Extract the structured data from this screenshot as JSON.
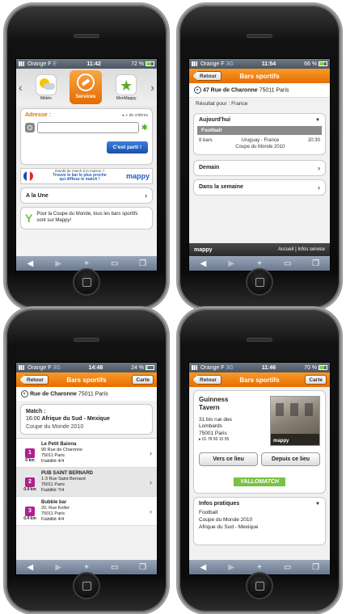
{
  "phone1": {
    "status": {
      "carrier": "Orange F",
      "network": "E",
      "time": "11:42",
      "battery": "72 %"
    },
    "menu": [
      {
        "label": "Météo"
      },
      {
        "label": "Services"
      },
      {
        "label": "MonMappy"
      }
    ],
    "address_label": "Adresse :",
    "criteria_link": "+ de critères",
    "go_button": "C'est parti !",
    "banner_line1": "Interdit de match à la maison ?",
    "banner_line2": "Trouve le bar le plus proche",
    "banner_line3": "qui diffuse le match !",
    "banner_brand": "mappy",
    "une": "A la Une",
    "promo": "Pour la Coupe du Monde, tous les bars sportifs sont sur Mappy!"
  },
  "phone2": {
    "status": {
      "carrier": "Orange F",
      "network": "3G",
      "time": "11:54",
      "battery": "66 %"
    },
    "back": "Retour",
    "title": "Bars sportifs",
    "address": "47 Rue de Charonne",
    "postcode": "75011 Paris",
    "result": "Résultat pour : France",
    "today": "Aujourd'hui",
    "sport": "Football",
    "count": "8 bars",
    "match": "Uruguay - France",
    "time": "20:30",
    "competition": "Coupe du Monde 2010",
    "demain": "Demain",
    "semaine": "Dans la semaine",
    "footer_brand": "mappy",
    "footer_links": "Accueil | Infos service"
  },
  "phone3": {
    "status": {
      "carrier": "Orange F",
      "network": "3G",
      "time": "14:48",
      "battery": "24 %"
    },
    "back": "Retour",
    "title": "Bars sportifs",
    "carte": "Carte",
    "address": "Rue de Charonne",
    "postcode": "75011 Paris",
    "match_label": "Match :",
    "match_time": "16:00",
    "match_teams": "Afrique du Sud - Mexique",
    "competition": "Coupe du Monde 2010",
    "bars": [
      {
        "rank": "1",
        "name": "Le Petit Baiona",
        "addr": "90 Rue de Charonne",
        "city": "75011 Paris",
        "fiab": "Fiabilité 4/4",
        "dist": "0 km"
      },
      {
        "rank": "2",
        "name": "PUB SAINT BERNARD",
        "addr": "1-3 Rue Saint Bernard",
        "city": "75011 Paris",
        "fiab": "Fiabilité ?/4",
        "dist": "0.4 km"
      },
      {
        "rank": "3",
        "name": "Bubble bar",
        "addr": "20, Rue Keller",
        "city": "75011 Paris",
        "fiab": "Fiabilité 4/4",
        "dist": "0.4 km"
      }
    ]
  },
  "phone4": {
    "status": {
      "carrier": "Orange F",
      "network": "3G",
      "time": "11:46",
      "battery": "70 %"
    },
    "back": "Retour",
    "title": "Bars sportifs",
    "carte": "Carte",
    "name1": "Guinness",
    "name2": "Tavern",
    "addr1": "31 bis rue des",
    "addr2": "Lombards",
    "city": "75001 Paris",
    "phone": "01 78 90 10 55",
    "photo_brand": "mappy",
    "btn_to": "Vers ce lieu",
    "btn_from": "Depuis ce lieu",
    "allomatch": "ALLOMATCH",
    "infos": "Infos pratiques",
    "sport": "Football",
    "competition": "Coupe du Monde 2010",
    "match": "Afrique du Sud - Mexique"
  },
  "toolbar_icons": [
    "back-icon",
    "forward-icon",
    "add-icon",
    "bookmarks-icon",
    "tabs-icon"
  ],
  "colors": {
    "accent": "#f08a1c",
    "brand_green": "#7ac143",
    "button_blue": "#1e5fbf",
    "rank_purple": "#b0208f"
  }
}
